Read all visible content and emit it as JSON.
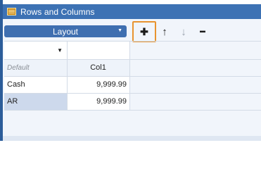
{
  "window": {
    "title": "Rows and Columns"
  },
  "toolbar": {
    "layout_label": "Layout",
    "caret": "▼",
    "add_glyph": "✚",
    "up_glyph": "↑",
    "down_glyph": "↓",
    "remove_glyph": "━"
  },
  "grid": {
    "filter_glyph": "▼",
    "default_label": "Default",
    "column_header": "Col1",
    "rows": [
      {
        "label": "Cash",
        "value": "9,999.99"
      },
      {
        "label": "AR",
        "value": "9,999.99"
      }
    ]
  },
  "colors": {
    "title_bar": "#3d72b4",
    "layout_button": "#3f6fb0",
    "highlight": "#e8932f",
    "selected_row": "#cdd9ec"
  }
}
